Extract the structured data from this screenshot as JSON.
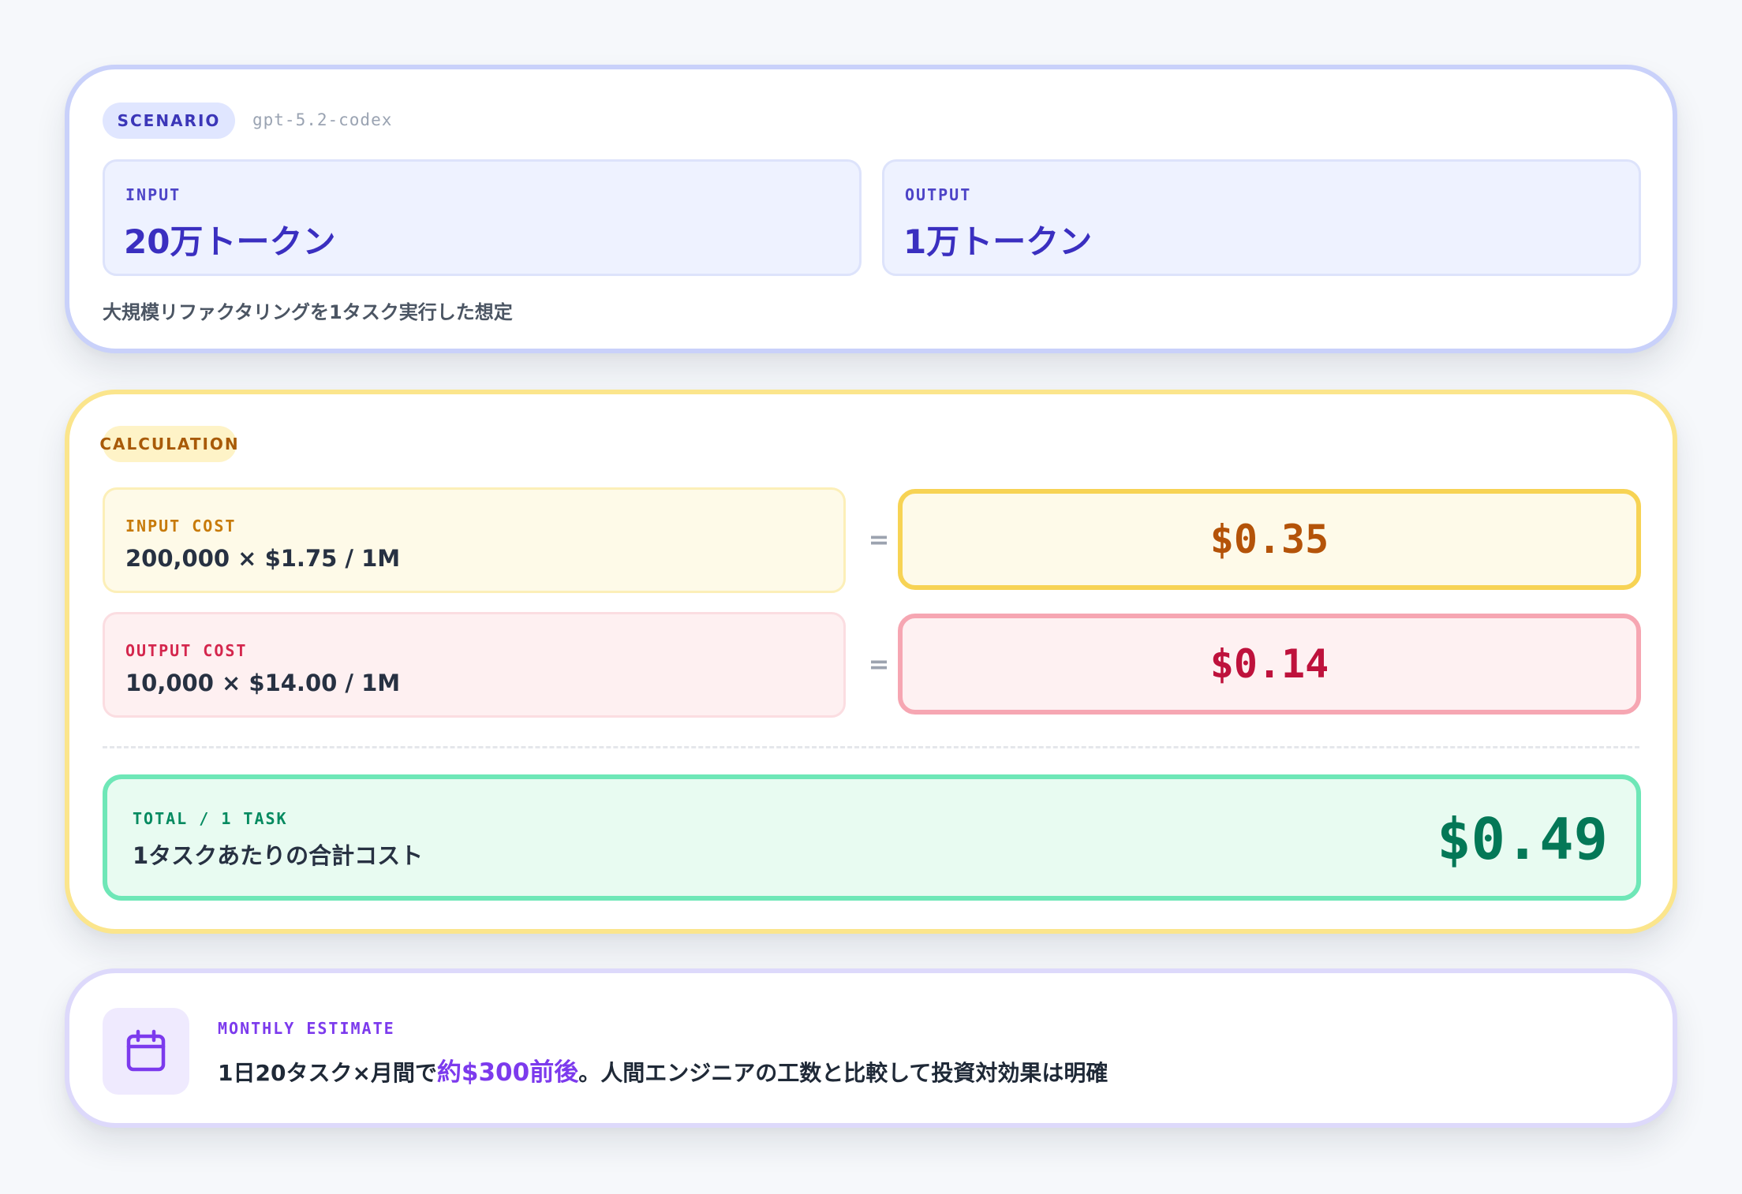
{
  "scenario": {
    "badge": "SCENARIO",
    "model": "gpt-5.2-codex",
    "input_label": "INPUT",
    "input_value": "20万トークン",
    "output_label": "OUTPUT",
    "output_value": "1万トークン",
    "description": "大規模リファクタリングを1タスク実行した想定"
  },
  "calculation": {
    "badge": "CALCULATION",
    "input_cost_label": "INPUT COST",
    "input_cost_formula": "200,000 × $1.75 / 1M",
    "input_cost_result": "$0.35",
    "output_cost_label": "OUTPUT COST",
    "output_cost_formula": "10,000 × $14.00 / 1M",
    "output_cost_result": "$0.14",
    "equals": "=",
    "total_label": "TOTAL / 1 TASK",
    "total_desc": "1タスクあたりの合計コスト",
    "total_value": "$0.49"
  },
  "monthly": {
    "icon": "calendar-icon",
    "label": "MONTHLY ESTIMATE",
    "text_before": "1日20タスク×月間で",
    "text_highlight": "約$300前後",
    "text_after": "。人間エンジニアの工数と比較して投資対効果は明確"
  },
  "colors": {
    "scenario_accent": "#3b36b8",
    "calc_accent": "#b45309",
    "output_accent": "#be123c",
    "total_accent": "#047857",
    "monthly_accent": "#7c3aed"
  }
}
